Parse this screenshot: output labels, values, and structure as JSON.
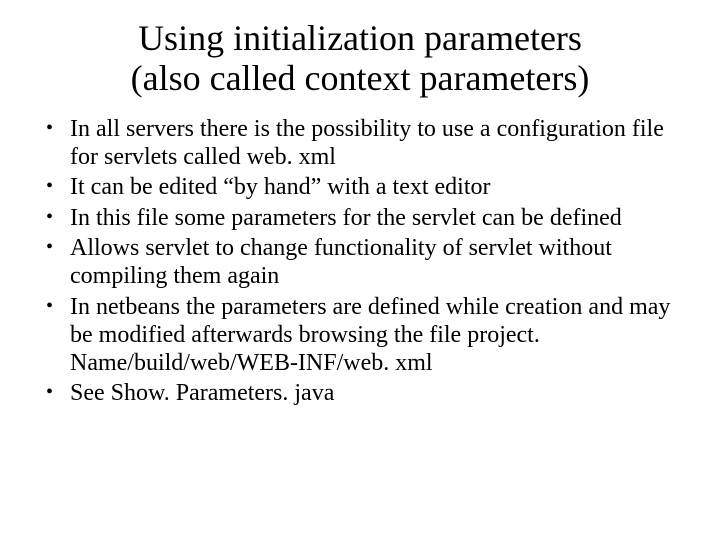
{
  "title_line1": "Using initialization parameters",
  "title_line2": "(also called context parameters)",
  "bullets": [
    "In all servers there is the possibility to use a configuration file for servlets called web. xml",
    "It can be edited “by hand”  with a text editor",
    "In this file some parameters for the servlet can be defined",
    "Allows servlet to change functionality of servlet  without compiling them again",
    "In netbeans the parameters are defined while creation and may be modified afterwards browsing the file project. Name/build/web/WEB-INF/web. xml",
    "See Show. Parameters. java"
  ]
}
